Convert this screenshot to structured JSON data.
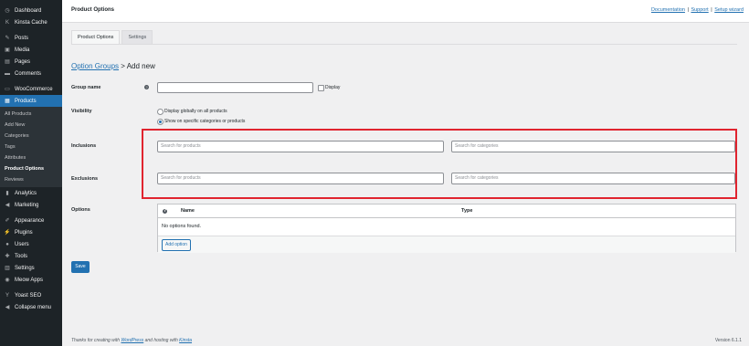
{
  "sidebar": {
    "items_top": [
      {
        "label": "Dashboard",
        "icon": "dashboard-icon",
        "glyph": "◷"
      },
      {
        "label": "Kinsta Cache",
        "icon": "kinsta-icon",
        "glyph": "K"
      },
      {
        "label": "Posts",
        "icon": "pin-icon",
        "glyph": "✎"
      },
      {
        "label": "Media",
        "icon": "media-icon",
        "glyph": "▣"
      },
      {
        "label": "Pages",
        "icon": "page-icon",
        "glyph": "▤"
      },
      {
        "label": "Comments",
        "icon": "comment-icon",
        "glyph": "▬"
      },
      {
        "label": "WooCommerce",
        "icon": "woocommerce-icon",
        "glyph": "▭"
      },
      {
        "label": "Products",
        "icon": "products-icon",
        "glyph": "▦"
      }
    ],
    "submenu": [
      "All Products",
      "Add New",
      "Categories",
      "Tags",
      "Attributes",
      "Product Options",
      "Reviews"
    ],
    "items_bottom": [
      {
        "label": "Analytics",
        "icon": "analytics-icon",
        "glyph": "▮"
      },
      {
        "label": "Marketing",
        "icon": "megaphone-icon",
        "glyph": "◀"
      },
      {
        "label": "Appearance",
        "icon": "brush-icon",
        "glyph": "✐"
      },
      {
        "label": "Plugins",
        "icon": "plugin-icon",
        "glyph": "⚡"
      },
      {
        "label": "Users",
        "icon": "users-icon",
        "glyph": "●"
      },
      {
        "label": "Tools",
        "icon": "tools-icon",
        "glyph": "✚"
      },
      {
        "label": "Settings",
        "icon": "settings-icon",
        "glyph": "▥"
      },
      {
        "label": "Meow Apps",
        "icon": "meow-icon",
        "glyph": "◉"
      },
      {
        "label": "Yoast SEO",
        "icon": "yoast-icon",
        "glyph": "Y"
      },
      {
        "label": "Collapse menu",
        "icon": "collapse-icon",
        "glyph": "◀"
      }
    ]
  },
  "header": {
    "title": "Product Options",
    "links": [
      "Documentation",
      "Support",
      "Setup wizard"
    ]
  },
  "tabs": [
    "Product Options",
    "Settings"
  ],
  "breadcrumb": {
    "link": "Option Groups",
    "rest": " > Add new"
  },
  "form": {
    "group_name_label": "Group name",
    "display_label": "Display",
    "visibility_label": "Visibility",
    "radio_global": "Display globally on all products",
    "radio_specific": "Show on specific categories or products",
    "inclusions_label": "Inclusions",
    "exclusions_label": "Exclusions",
    "search_products": "Search for products",
    "search_categories": "Search for categories",
    "options_label": "Options",
    "col_name": "Name",
    "col_type": "Type",
    "empty_text": "No options found.",
    "add_option": "Add option",
    "save": "Save"
  },
  "footer": {
    "left_prefix": "Thanks for creating with ",
    "wordpress": "WordPress",
    "middle": " and hosting with ",
    "kinsta": "Kinsta",
    "version": "Version 6.1.1"
  }
}
